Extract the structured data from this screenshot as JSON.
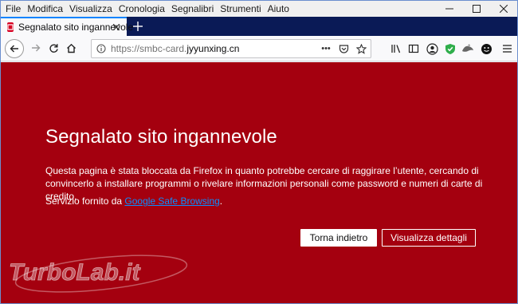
{
  "menu": {
    "items": [
      "File",
      "Modifica",
      "Visualizza",
      "Cronologia",
      "Segnalibri",
      "Strumenti",
      "Aiuto"
    ]
  },
  "tab": {
    "title": "Segnalato sito ingannevole"
  },
  "urlbar": {
    "scheme": "https://",
    "host_prefix": "smbc-card.",
    "host": "jyyunxing.cn",
    "page_actions": "•••"
  },
  "error_page": {
    "title": "Segnalato sito ingannevole",
    "description": "Questa pagina è stata bloccata da Firefox in quanto potrebbe cercare di raggirare l’utente, cercando di convincerlo a installare programmi o rivelare informazioni personali come password e numeri di carte di credito.",
    "provider_prefix": "Servizio fornito da ",
    "provider_link": "Google Safe Browsing",
    "provider_suffix": ".",
    "go_back_label": "Torna indietro",
    "details_label": "Visualizza dettagli"
  },
  "watermark": {
    "text_part1": "Turbo",
    "text_part2": "Lab.it"
  },
  "colors": {
    "error_background": "#a4000f",
    "tabstrip": "#0a1a56",
    "accent": "#0a84ff",
    "link": "#0a8dff"
  },
  "icons": [
    "minimize-icon",
    "maximize-icon",
    "close-window-icon",
    "tab-warning-favicon",
    "tab-close-icon",
    "new-tab-icon",
    "back-icon",
    "forward-icon",
    "reload-icon",
    "home-icon",
    "info-icon",
    "pocket-icon",
    "bookmark-star-icon",
    "library-icon",
    "sidebar-icon",
    "account-icon",
    "shield-extension-icon",
    "extension-icon",
    "emoji-extension-icon",
    "menu-icon"
  ]
}
